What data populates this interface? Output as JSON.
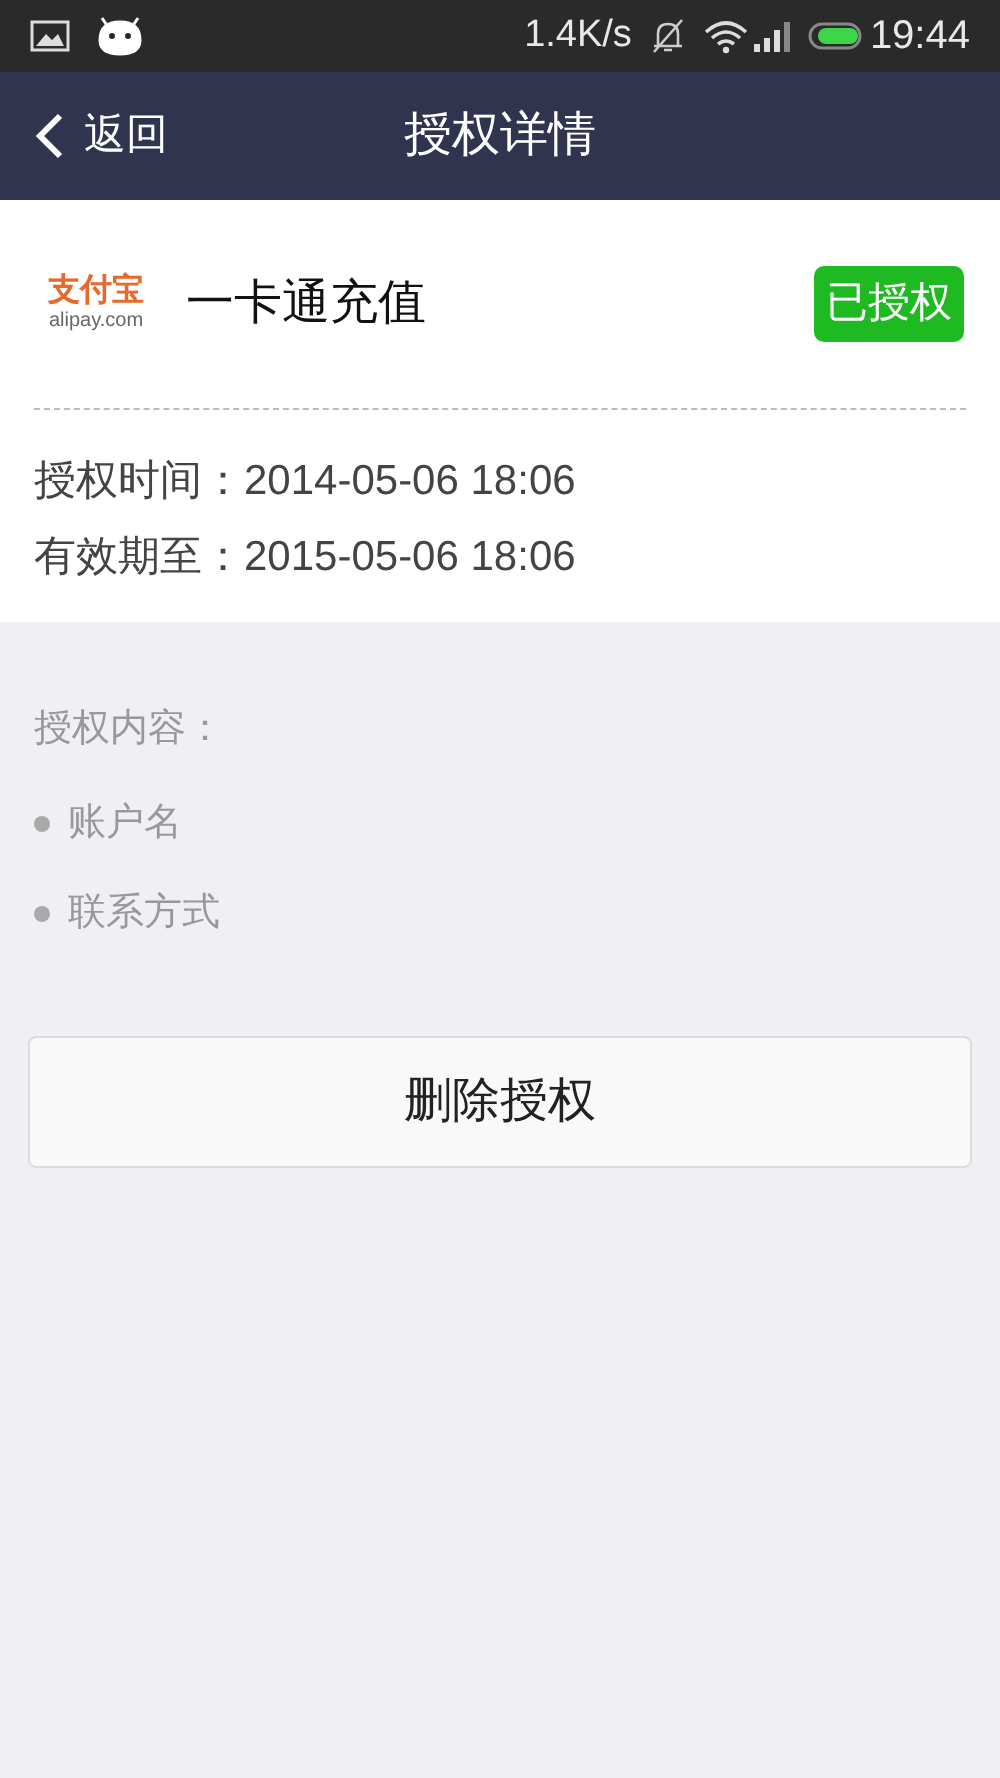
{
  "status_bar": {
    "speed": "1.4K/s",
    "time": "19:44"
  },
  "nav": {
    "back": "返回",
    "title": "授权详情"
  },
  "app": {
    "logo_text": "支付宝",
    "logo_domain": "alipay.com",
    "name": "一卡通充值",
    "badge": "已授权"
  },
  "details": [
    "授权时间：2014-05-06 18:06",
    "有效期至：2015-05-06 18:06"
  ],
  "permissions": {
    "heading": "授权内容：",
    "items": [
      "账户名",
      "联系方式"
    ]
  },
  "delete_button": "删除授权"
}
